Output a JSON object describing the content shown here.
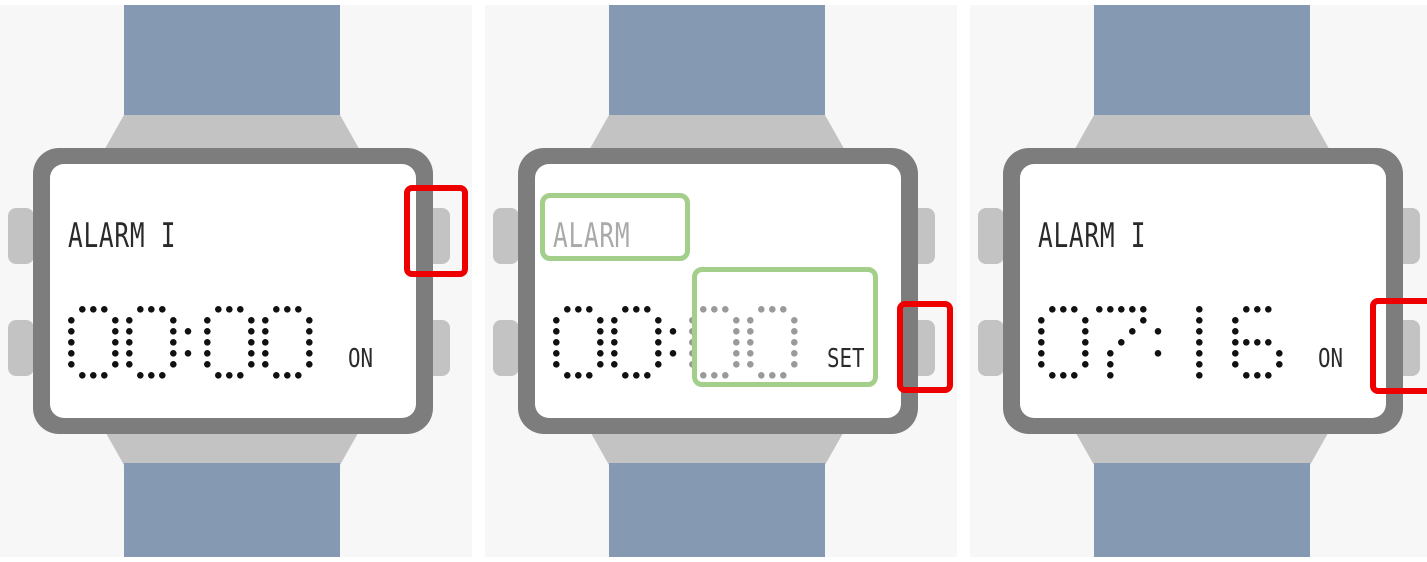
{
  "panels": [
    {
      "alarm_label": "ALARM I",
      "hours": "00",
      "minutes": "00",
      "state": "ON",
      "hours_dimmed": false,
      "minutes_dimmed": false,
      "label_dimmed": false,
      "highlighted_button": "top-right"
    },
    {
      "alarm_label": "ALARM",
      "hours": "00",
      "minutes": "00",
      "state": "SET",
      "hours_dimmed": false,
      "minutes_dimmed": true,
      "label_dimmed": true,
      "highlighted_button": "bottom-right",
      "green_highlights": [
        "alarm-label",
        "minutes"
      ]
    },
    {
      "alarm_label": "ALARM I",
      "hours": "07",
      "minutes": "16",
      "state": "ON",
      "hours_dimmed": false,
      "minutes_dimmed": false,
      "label_dimmed": false,
      "highlighted_button": "bottom-right"
    }
  ],
  "colors": {
    "band": "#8599b3",
    "case": "#7d7d7d",
    "lug": "#c3c3c3",
    "lcd_dot": "#111111",
    "lcd_dim": "#9a9a9a",
    "red_callout": "#ee0000",
    "green_callout": "#a4cf8b"
  }
}
